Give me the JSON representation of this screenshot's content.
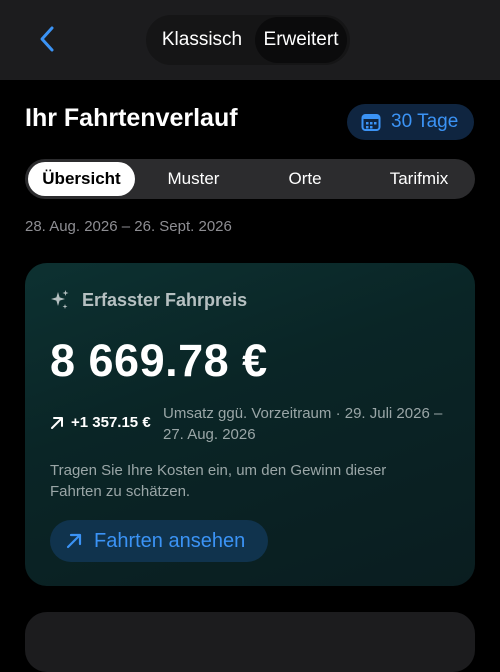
{
  "nav": {
    "back_icon": "chevron-left-icon",
    "modes": [
      "Klassisch",
      "Erweitert"
    ],
    "active_mode": "Erweitert"
  },
  "header": {
    "title": "Ihr Fahrtenverlauf",
    "range_label": "30 Tage",
    "range_icon": "calendar-icon"
  },
  "tabs": [
    {
      "label": "Übersicht",
      "active": true
    },
    {
      "label": "Muster",
      "active": false
    },
    {
      "label": "Orte",
      "active": false
    },
    {
      "label": "Tarifmix",
      "active": false
    }
  ],
  "date_range": "28. Aug. 2026 – 26. Sept. 2026",
  "card": {
    "icon": "sparkles-icon",
    "label": "Erfasster Fahrpreis",
    "amount": "8 669.78 €",
    "delta_icon": "arrow-up-right-icon",
    "delta": "+1 357.15 €",
    "compare": "Umsatz ggü. Vorzeitraum · 29. Juli 2026 – 27. Aug. 2026",
    "hint": "Tragen Sie Ihre Kosten ein, um den Gewinn dieser Fahrten zu schätzen.",
    "cta_label": "Fahrten ansehen",
    "cta_icon": "arrow-up-right-icon"
  },
  "colors": {
    "accent": "#3b93f5",
    "background": "#000000",
    "card": "#0d3131"
  }
}
